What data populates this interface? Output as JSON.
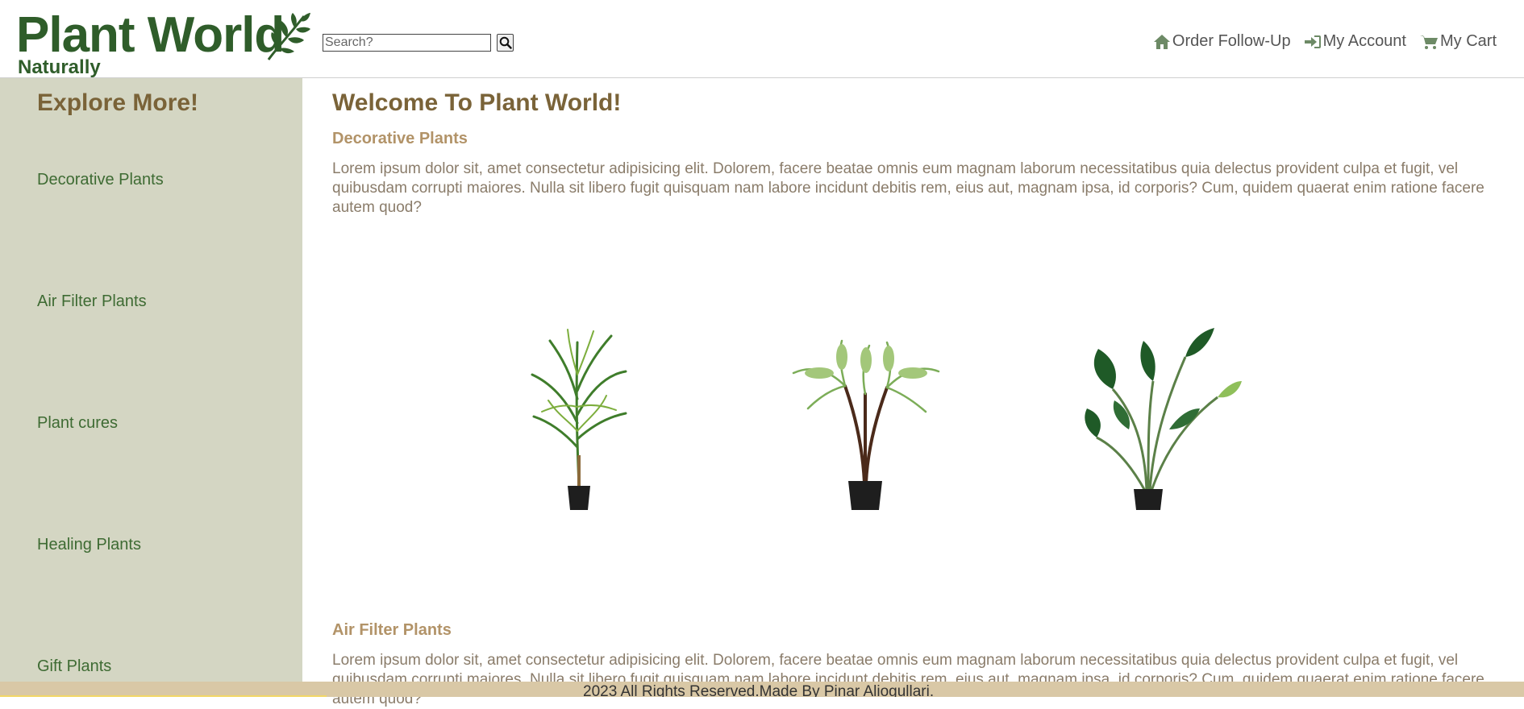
{
  "brand": {
    "title": "Plant World",
    "subtitle": "Naturally",
    "logo_icon": "leaf-icon",
    "color": "#2f5d2a"
  },
  "search": {
    "placeholder": "Search?",
    "value": "",
    "button_icon": "search-icon"
  },
  "top_nav": [
    {
      "label": "Order Follow-Up",
      "icon": "home-icon"
    },
    {
      "label": "My Account",
      "icon": "sign-in-icon"
    },
    {
      "label": "My Cart",
      "icon": "cart-icon"
    }
  ],
  "sidebar": {
    "title": "Explore More!",
    "items": [
      {
        "label": "Decorative Plants"
      },
      {
        "label": "Air Filter Plants"
      },
      {
        "label": "Plant cures"
      },
      {
        "label": "Healing Plants"
      },
      {
        "label": "Gift Plants"
      }
    ]
  },
  "main": {
    "title": "Welcome To Plant World!",
    "sections": [
      {
        "heading": "Decorative Plants",
        "text": "Lorem ipsum dolor sit, amet consectetur adipisicing elit. Dolorem, facere beatae omnis eum magnam laborum necessitatibus quia delectus provident culpa et fugit, vel quibusdam corrupti maiores. Nulla sit libero fugit quisquam nam labore incidunt debitis rem, eius aut, magnam ipsa, id corporis? Cum, quidem quaerat enim ratione facere autem quod?",
        "images": [
          "areca-palm-plant-image",
          "fern-tree-plant-image",
          "bird-of-paradise-plant-image"
        ]
      },
      {
        "heading": "Air Filter Plants",
        "text": "Lorem ipsum dolor sit, amet consectetur adipisicing elit. Dolorem, facere beatae omnis eum magnam laborum necessitatibus quia delectus provident culpa et fugit, vel quibusdam corrupti maiores. Nulla sit libero fugit quisquam nam labore incidunt debitis rem, eius aut, magnam ipsa, id corporis? Cum, quidem quaerat enim ratione facere autem quod?"
      }
    ]
  },
  "footer": {
    "text": "2023 All Rights Reserved.Made By Pinar Aliogullari."
  },
  "colors": {
    "sidebar_bg": "#d4d6c3",
    "heading_brown": "#7a6338",
    "subheading_tan": "#b29368",
    "body_text": "#8a7c6a",
    "link_green": "#3e6b33",
    "footer_bg": "#d9c8a6"
  }
}
